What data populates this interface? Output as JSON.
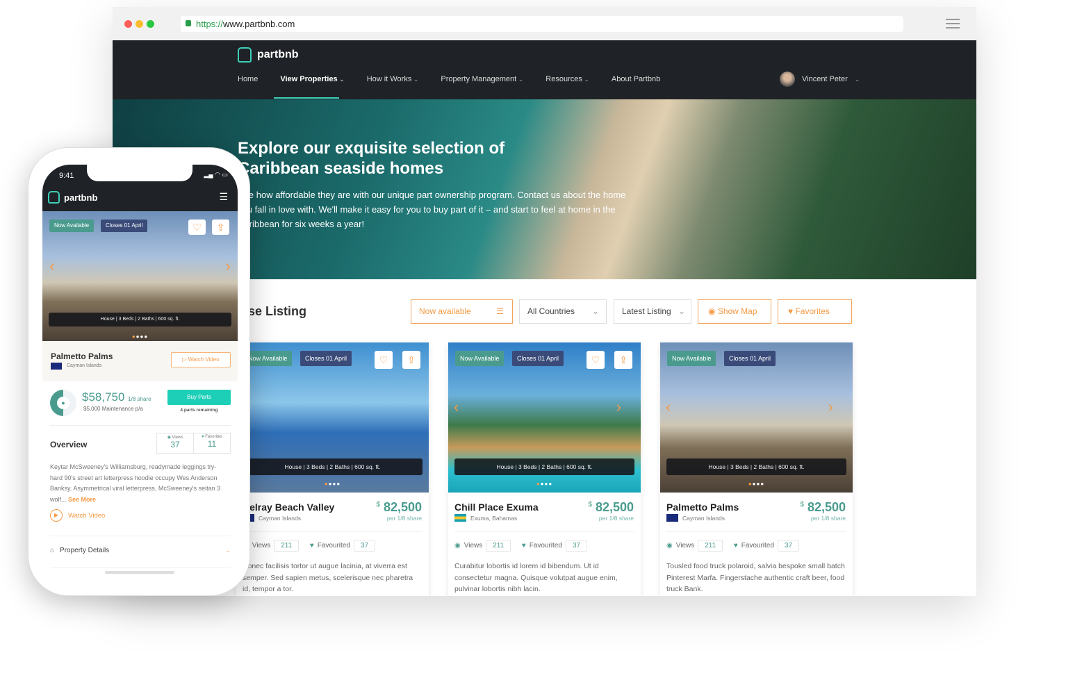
{
  "browser": {
    "url_scheme": "https://",
    "url_host": "www.partbnb.com"
  },
  "nav": {
    "brand": "partbnb",
    "items": [
      "Home",
      "View Properties",
      "How it Works",
      "Property Management",
      "Resources",
      "About Partbnb"
    ],
    "user": "Vincent Peter"
  },
  "hero": {
    "title": "Explore our exquisite selection of Caribbean seaside homes",
    "text": "See how affordable they are with our unique part ownership program. Contact us about the home you fall in love with. We'll make it easy for you to buy part of it – and start to feel at home in the Caribbean for six weeks a year!"
  },
  "listing": {
    "title": "Browse Listing",
    "filters": {
      "availability": "Now available",
      "country": "All Countries",
      "sort": "Latest Listing",
      "show_map": "Show Map",
      "favorites": "Favorites"
    }
  },
  "cards": [
    {
      "tag1": "Now Available",
      "tag2": "Closes 01 April",
      "features": "House  |  3 Beds  |  2 Baths  |  600 sq. ft.",
      "title": "Delray Beach Valley",
      "location": "Cayman Islands",
      "currency": "$",
      "price": "82,500",
      "per": "per 1/8 share",
      "views_label": "Views",
      "views": "211",
      "fav_label": "Favourited",
      "favs": "37",
      "desc": "Donec facilisis tortor ut augue lacinia, at viverra est semper. Sed sapien metus, scelerisque nec pharetra id, tempor a tor."
    },
    {
      "tag1": "Now Available",
      "tag2": "Closes 01 April",
      "features": "House  |  3 Beds  |  2 Baths  |  600 sq. ft.",
      "title": "Chill Place Exuma",
      "location": "Exuma, Bahamas",
      "currency": "$",
      "price": "82,500",
      "per": "per 1/8 share",
      "views_label": "Views",
      "views": "211",
      "fav_label": "Favourited",
      "favs": "37",
      "desc": "Curabitur lobortis id lorem id bibendum. Ut id consectetur magna. Quisque volutpat augue enim, pulvinar lobortis nibh lacin."
    },
    {
      "tag1": "Now Available",
      "tag2": "Closes 01 April",
      "features": "House  |  3 Beds  |  2 Baths  |  600 sq. ft.",
      "title": "Palmetto Palms",
      "location": "Cayman Islands",
      "currency": "$",
      "price": "82,500",
      "per": "per 1/8 share",
      "views_label": "Views",
      "views": "211",
      "fav_label": "Favourited",
      "favs": "37",
      "desc": "Tousled food truck polaroid, salvia bespoke small batch Pinterest Marfa. Fingerstache authentic craft beer, food truck Bank."
    }
  ],
  "phone": {
    "time": "9:41",
    "brand": "partbnb",
    "tag1": "Now Available",
    "tag2": "Closes 01 April",
    "features": "House  |  3 Beds  |  2 Baths  |  600 sq. ft.",
    "title": "Palmetto Palms",
    "location": "Cayman Islands",
    "watch_video": "Watch Video",
    "price": "$58,750",
    "share": "1/8 share",
    "maintenance": "$5,000 Maintenance p/a",
    "buy": "Buy Parts",
    "remaining": "4 parts remaining",
    "overview": "Overview",
    "views_label": "Views",
    "views": "37",
    "fav_label": "Favorites",
    "favs": "11",
    "desc": "Keytar McSweeney's Williamsburg, readymade leggings try-hard 90's street art letterpress hoodie occupy Wes Anderson Banksy. Asymmetrical viral letterpress, McSweeney's seitan 3 wolf...",
    "see_more": "See More",
    "watch_video2": "Watch Video",
    "property_details": "Property Details",
    "owned_fraction": 0.5
  },
  "colors": {
    "accent": "#4a9b8e",
    "orange": "#f59a45",
    "nav_bg": "#1f2226",
    "button": "#1ecfb8"
  }
}
